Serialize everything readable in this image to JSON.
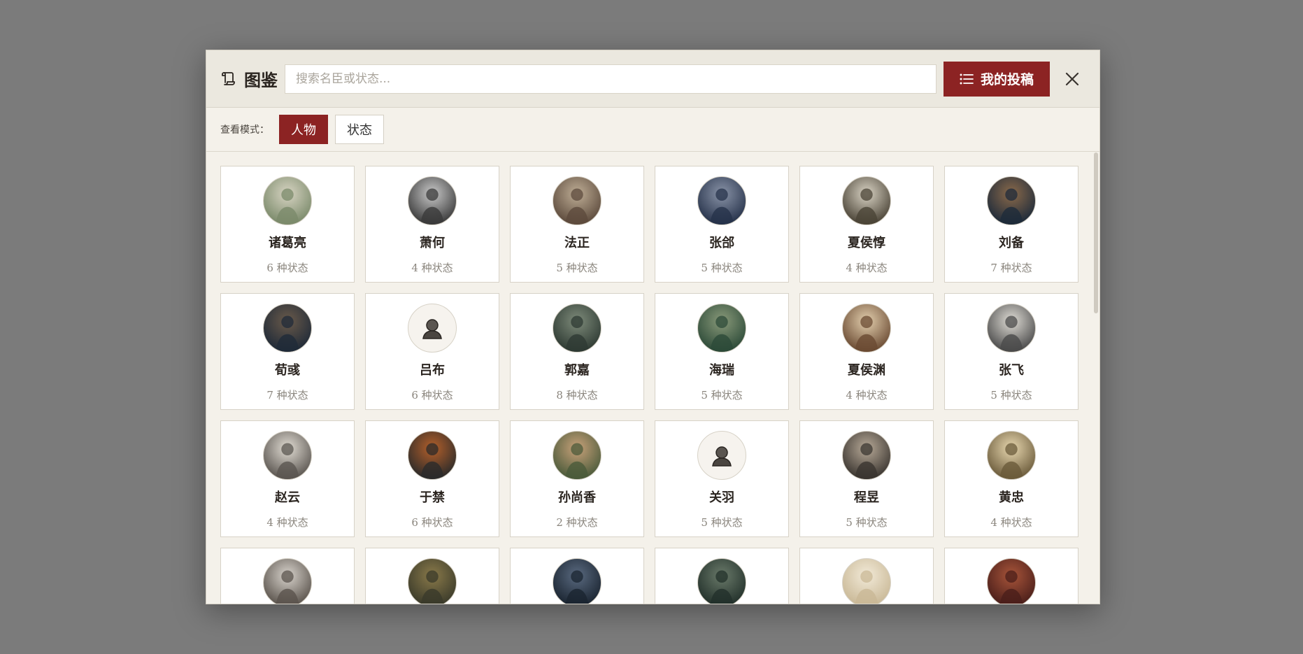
{
  "header": {
    "icon": "scroll-icon",
    "title": "图鉴",
    "search_placeholder": "搜索名臣或状态...",
    "submit_label": "我的投稿",
    "submit_icon": "list-icon",
    "close_icon": "close-icon"
  },
  "modebar": {
    "label": "查看模式：",
    "modes": [
      {
        "label": "人物",
        "active": true
      },
      {
        "label": "状态",
        "active": false
      }
    ]
  },
  "colors": {
    "accent": "#8c2323",
    "overlay": "#7b7b7b",
    "panel": "#f4f1ea"
  },
  "characters": [
    {
      "name": "诸葛亮",
      "count": "6 种状态",
      "avatar": "portrait",
      "tone": [
        "#7a8a6a",
        "#d8d4c3"
      ]
    },
    {
      "name": "萧何",
      "count": "4 种状态",
      "avatar": "portrait",
      "tone": [
        "#3a3a3a",
        "#c9c9c9"
      ]
    },
    {
      "name": "法正",
      "count": "5 种状态",
      "avatar": "portrait",
      "tone": [
        "#5c4a3c",
        "#bfae96"
      ]
    },
    {
      "name": "张郃",
      "count": "5 种状态",
      "avatar": "portrait",
      "tone": [
        "#26324a",
        "#8a94a8"
      ]
    },
    {
      "name": "夏侯惇",
      "count": "4 种状态",
      "avatar": "portrait",
      "tone": [
        "#4a4336",
        "#d9d3c4"
      ]
    },
    {
      "name": "刘备",
      "count": "7 种状态",
      "avatar": "portrait",
      "tone": [
        "#1d2a3a",
        "#8b6a4a"
      ]
    },
    {
      "name": "荀彧",
      "count": "7 种状态",
      "avatar": "portrait",
      "tone": [
        "#1f2a38",
        "#6a5a4a"
      ]
    },
    {
      "name": "吕布",
      "count": "6 种状态",
      "avatar": "placeholder",
      "tone": [
        "#f6f3ee",
        "#f6f3ee"
      ]
    },
    {
      "name": "郭嘉",
      "count": "8 种状态",
      "avatar": "portrait",
      "tone": [
        "#2e3a33",
        "#7e8b7a"
      ]
    },
    {
      "name": "海瑞",
      "count": "5 种状态",
      "avatar": "portrait",
      "tone": [
        "#2c4a38",
        "#8a9a7a"
      ]
    },
    {
      "name": "夏侯渊",
      "count": "4 种状态",
      "avatar": "portrait",
      "tone": [
        "#6a4a32",
        "#e3cfae"
      ]
    },
    {
      "name": "张飞",
      "count": "5 种状态",
      "avatar": "portrait",
      "tone": [
        "#4a4a4a",
        "#e0ddd6"
      ]
    },
    {
      "name": "赵云",
      "count": "4 种状态",
      "avatar": "portrait",
      "tone": [
        "#5a5550",
        "#e2ddd4"
      ]
    },
    {
      "name": "于禁",
      "count": "6 种状态",
      "avatar": "portrait",
      "tone": [
        "#2a2a2a",
        "#b5602a"
      ]
    },
    {
      "name": "孙尚香",
      "count": "2 种状态",
      "avatar": "portrait",
      "tone": [
        "#4a5a3a",
        "#c9a27a"
      ]
    },
    {
      "name": "关羽",
      "count": "5 种状态",
      "avatar": "placeholder",
      "tone": [
        "#f6f3ee",
        "#f6f3ee"
      ]
    },
    {
      "name": "程昱",
      "count": "5 种状态",
      "avatar": "portrait",
      "tone": [
        "#3a3530",
        "#b8aa98"
      ]
    },
    {
      "name": "黄忠",
      "count": "4 种状态",
      "avatar": "portrait",
      "tone": [
        "#6a5a3a",
        "#e9d8b0"
      ]
    },
    {
      "name": "",
      "count": "",
      "avatar": "portrait",
      "tone": [
        "#5a534c",
        "#d8d3cc"
      ]
    },
    {
      "name": "",
      "count": "",
      "avatar": "portrait",
      "tone": [
        "#3a3a2a",
        "#8a7a4a"
      ]
    },
    {
      "name": "",
      "count": "",
      "avatar": "portrait",
      "tone": [
        "#1a2430",
        "#5a6a80"
      ]
    },
    {
      "name": "",
      "count": "",
      "avatar": "portrait",
      "tone": [
        "#22302a",
        "#6a7a6a"
      ]
    },
    {
      "name": "",
      "count": "",
      "avatar": "portrait",
      "tone": [
        "#c9b896",
        "#f2ead8"
      ]
    },
    {
      "name": "",
      "count": "",
      "avatar": "portrait",
      "tone": [
        "#4a1e1a",
        "#a8553a"
      ]
    }
  ]
}
